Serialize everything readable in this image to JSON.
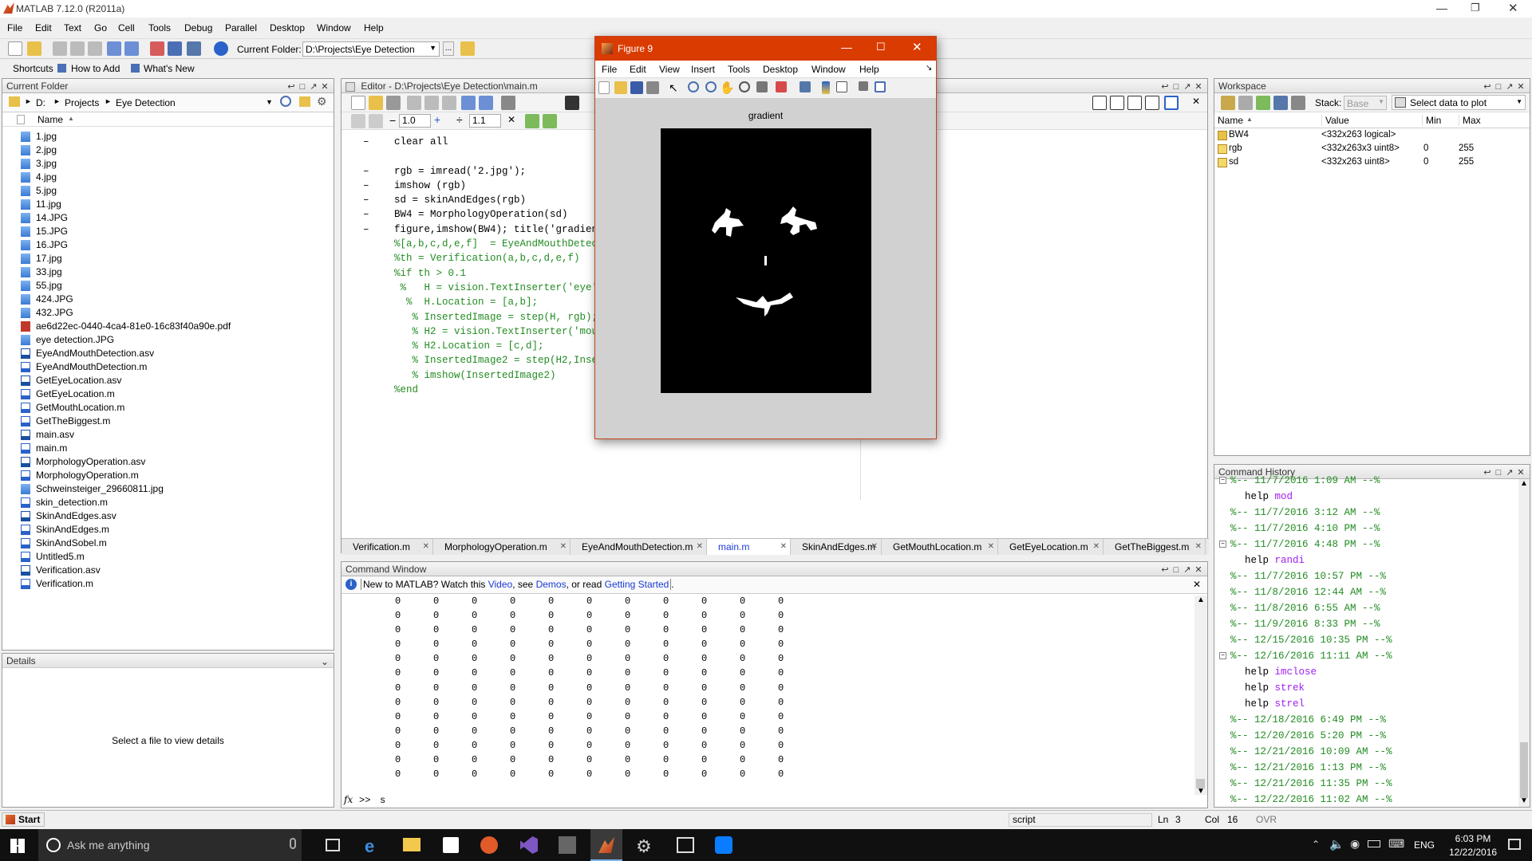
{
  "app": {
    "title": "MATLAB 7.12.0 (R2011a)"
  },
  "menubar": [
    "File",
    "Edit",
    "Text",
    "Go",
    "Cell",
    "Tools",
    "Debug",
    "Parallel",
    "Desktop",
    "Window",
    "Help"
  ],
  "toolbar": {
    "current_folder_label": "Current Folder:",
    "current_folder_value": "D:\\Projects\\Eye Detection"
  },
  "shortcuts": {
    "label": "Shortcuts",
    "how_to_add": "How to Add",
    "whats_new": "What's New"
  },
  "current_folder": {
    "title": "Current Folder",
    "path": [
      "D:",
      "Projects",
      "Eye Detection"
    ],
    "column_name": "Name",
    "files": [
      {
        "name": "1.jpg",
        "type": "img"
      },
      {
        "name": "2.jpg",
        "type": "img"
      },
      {
        "name": "3.jpg",
        "type": "img"
      },
      {
        "name": "4.jpg",
        "type": "img"
      },
      {
        "name": "5.jpg",
        "type": "img"
      },
      {
        "name": "11.jpg",
        "type": "img"
      },
      {
        "name": "14.JPG",
        "type": "img"
      },
      {
        "name": "15.JPG",
        "type": "img"
      },
      {
        "name": "16.JPG",
        "type": "img"
      },
      {
        "name": "17.jpg",
        "type": "img"
      },
      {
        "name": "33.jpg",
        "type": "img"
      },
      {
        "name": "55.jpg",
        "type": "img"
      },
      {
        "name": "424.JPG",
        "type": "img"
      },
      {
        "name": "432.JPG",
        "type": "img"
      },
      {
        "name": "ae6d22ec-0440-4ca4-81e0-16c83f40a90e.pdf",
        "type": "pdf"
      },
      {
        "name": "eye detection.JPG",
        "type": "img"
      },
      {
        "name": "EyeAndMouthDetection.asv",
        "type": "asv"
      },
      {
        "name": "EyeAndMouthDetection.m",
        "type": "m"
      },
      {
        "name": "GetEyeLocation.asv",
        "type": "asv"
      },
      {
        "name": "GetEyeLocation.m",
        "type": "m"
      },
      {
        "name": "GetMouthLocation.m",
        "type": "m"
      },
      {
        "name": "GetTheBiggest.m",
        "type": "m"
      },
      {
        "name": "main.asv",
        "type": "asv"
      },
      {
        "name": "main.m",
        "type": "m"
      },
      {
        "name": "MorphologyOperation.asv",
        "type": "asv"
      },
      {
        "name": "MorphologyOperation.m",
        "type": "m"
      },
      {
        "name": "Schweinsteiger_29660811.jpg",
        "type": "img"
      },
      {
        "name": "skin_detection.m",
        "type": "m"
      },
      {
        "name": "SkinAndEdges.asv",
        "type": "asv"
      },
      {
        "name": "SkinAndEdges.m",
        "type": "m"
      },
      {
        "name": "SkinAndSobel.m",
        "type": "m"
      },
      {
        "name": "Untitled5.m",
        "type": "m"
      },
      {
        "name": "Verification.asv",
        "type": "asv"
      },
      {
        "name": "Verification.m",
        "type": "m"
      }
    ]
  },
  "details": {
    "title": "Details",
    "placeholder": "Select a file to view details"
  },
  "editor": {
    "title": "Editor - D:\\Projects\\Eye Detection\\main.m",
    "zoom1": "1.0",
    "zoom2": "1.1",
    "lines": [
      {
        "dash": "–",
        "text": "clear all",
        "cls": ""
      },
      {
        "dash": "",
        "text": "",
        "cls": ""
      },
      {
        "dash": "–",
        "text": "rgb = imread('2.jpg');",
        "cls": ""
      },
      {
        "dash": "–",
        "text": "imshow (rgb)",
        "cls": ""
      },
      {
        "dash": "–",
        "text": "sd = skinAndEdges(rgb)",
        "cls": ""
      },
      {
        "dash": "–",
        "text": "BW4 = MorphologyOperation(sd)",
        "cls": ""
      },
      {
        "dash": "–",
        "text": "figure,imshow(BW4); title('gradient');",
        "cls": ""
      },
      {
        "dash": "",
        "text": "%[a,b,c,d,e,f]  = EyeAndMouthDetection(BW4);",
        "cls": "green"
      },
      {
        "dash": "",
        "text": "%th = Verification(a,b,c,d,e,f)",
        "cls": "green"
      },
      {
        "dash": "",
        "text": "%if th > 0.1",
        "cls": "green"
      },
      {
        "dash": "",
        "text": " %   H = vision.TextInserter('eye');",
        "cls": "green"
      },
      {
        "dash": "",
        "text": "  %  H.Location = [a,b];",
        "cls": "green"
      },
      {
        "dash": "",
        "text": "   % InsertedImage = step(H, rgb);",
        "cls": "green"
      },
      {
        "dash": "",
        "text": "   % H2 = vision.TextInserter('mouth');",
        "cls": "green"
      },
      {
        "dash": "",
        "text": "   % H2.Location = [c,d];",
        "cls": "green"
      },
      {
        "dash": "",
        "text": "   % InsertedImage2 = step(H2,InsertedImage);",
        "cls": "green"
      },
      {
        "dash": "",
        "text": "   % imshow(InsertedImage2)",
        "cls": "green"
      },
      {
        "dash": "",
        "text": "%end",
        "cls": "green"
      }
    ],
    "tabs": [
      "Verification.m",
      "MorphologyOperation.m",
      "EyeAndMouthDetection.m",
      "main.m",
      "SkinAndEdges.m",
      "GetMouthLocation.m",
      "GetEyeLocation.m",
      "GetTheBiggest.m"
    ]
  },
  "figure": {
    "title": "Figure 9",
    "menus": [
      "File",
      "Edit",
      "View",
      "Insert",
      "Tools",
      "Desktop",
      "Window",
      "Help"
    ],
    "plot_title": "gradient"
  },
  "command_window": {
    "title": "Command Window",
    "info_prefix": "New to MATLAB? Watch this ",
    "info_video": "Video",
    "info_mid": ", see ",
    "info_demos": "Demos",
    "info_mid2": ", or read ",
    "info_getting_started": "Getting Started",
    "info_end": ".",
    "matrix_row": [
      "0",
      "0",
      "0",
      "0",
      "0",
      "0",
      "0",
      "0",
      "0",
      "0",
      "0"
    ],
    "matrix_rows": 13,
    "prompt": ">>",
    "input": "s"
  },
  "workspace": {
    "title": "Workspace",
    "stack_label": "Stack:",
    "stack_value": "Base",
    "select_data": "Select data to plot",
    "columns": [
      "Name",
      "Value",
      "Min",
      "Max"
    ],
    "vars": [
      {
        "name": "BW4",
        "value": "<332x263 logical>",
        "min": "",
        "max": ""
      },
      {
        "name": "rgb",
        "value": "<332x263x3 uint8>",
        "min": "0",
        "max": "255"
      },
      {
        "name": "sd",
        "value": "<332x263 uint8>",
        "min": "0",
        "max": "255"
      }
    ]
  },
  "history": {
    "title": "Command History",
    "items": [
      {
        "t": "%-- 11/7/2016 1:09 AM --%",
        "type": "stamp",
        "box": true
      },
      {
        "t": "help mod",
        "type": "cmd"
      },
      {
        "t": "%-- 11/7/2016 3:12 AM --%",
        "type": "stamp"
      },
      {
        "t": "%-- 11/7/2016 4:10 PM --%",
        "type": "stamp"
      },
      {
        "t": "%-- 11/7/2016 4:48 PM --%",
        "type": "stamp",
        "box": true
      },
      {
        "t": "help randi",
        "type": "cmd"
      },
      {
        "t": "%-- 11/7/2016 10:57 PM --%",
        "type": "stamp"
      },
      {
        "t": "%-- 11/8/2016 12:44 AM --%",
        "type": "stamp"
      },
      {
        "t": "%-- 11/8/2016 6:55 AM --%",
        "type": "stamp"
      },
      {
        "t": "%-- 11/9/2016 8:33 PM --%",
        "type": "stamp"
      },
      {
        "t": "%-- 12/15/2016 10:35 PM --%",
        "type": "stamp"
      },
      {
        "t": "%-- 12/16/2016 11:11 AM --%",
        "type": "stamp",
        "box": true
      },
      {
        "t": "help imclose",
        "type": "cmd"
      },
      {
        "t": "help strek",
        "type": "cmd"
      },
      {
        "t": "help strel",
        "type": "cmd"
      },
      {
        "t": "%-- 12/18/2016 6:49 PM --%",
        "type": "stamp"
      },
      {
        "t": "%-- 12/20/2016 5:20 PM --%",
        "type": "stamp"
      },
      {
        "t": "%-- 12/21/2016 10:09 AM --%",
        "type": "stamp"
      },
      {
        "t": "%-- 12/21/2016 1:13 PM --%",
        "type": "stamp"
      },
      {
        "t": "%-- 12/21/2016 11:35 PM --%",
        "type": "stamp"
      },
      {
        "t": "%-- 12/22/2016 11:02 AM --%",
        "type": "stamp"
      }
    ]
  },
  "statusbar": {
    "start": "Start",
    "mode": "script",
    "ln_label": "Ln",
    "ln": "3",
    "col_label": "Col",
    "col": "16",
    "ovr": "OVR"
  },
  "taskbar": {
    "search_placeholder": "Ask me anything",
    "lang": "ENG",
    "time": "6:03 PM",
    "date": "12/22/2016"
  }
}
